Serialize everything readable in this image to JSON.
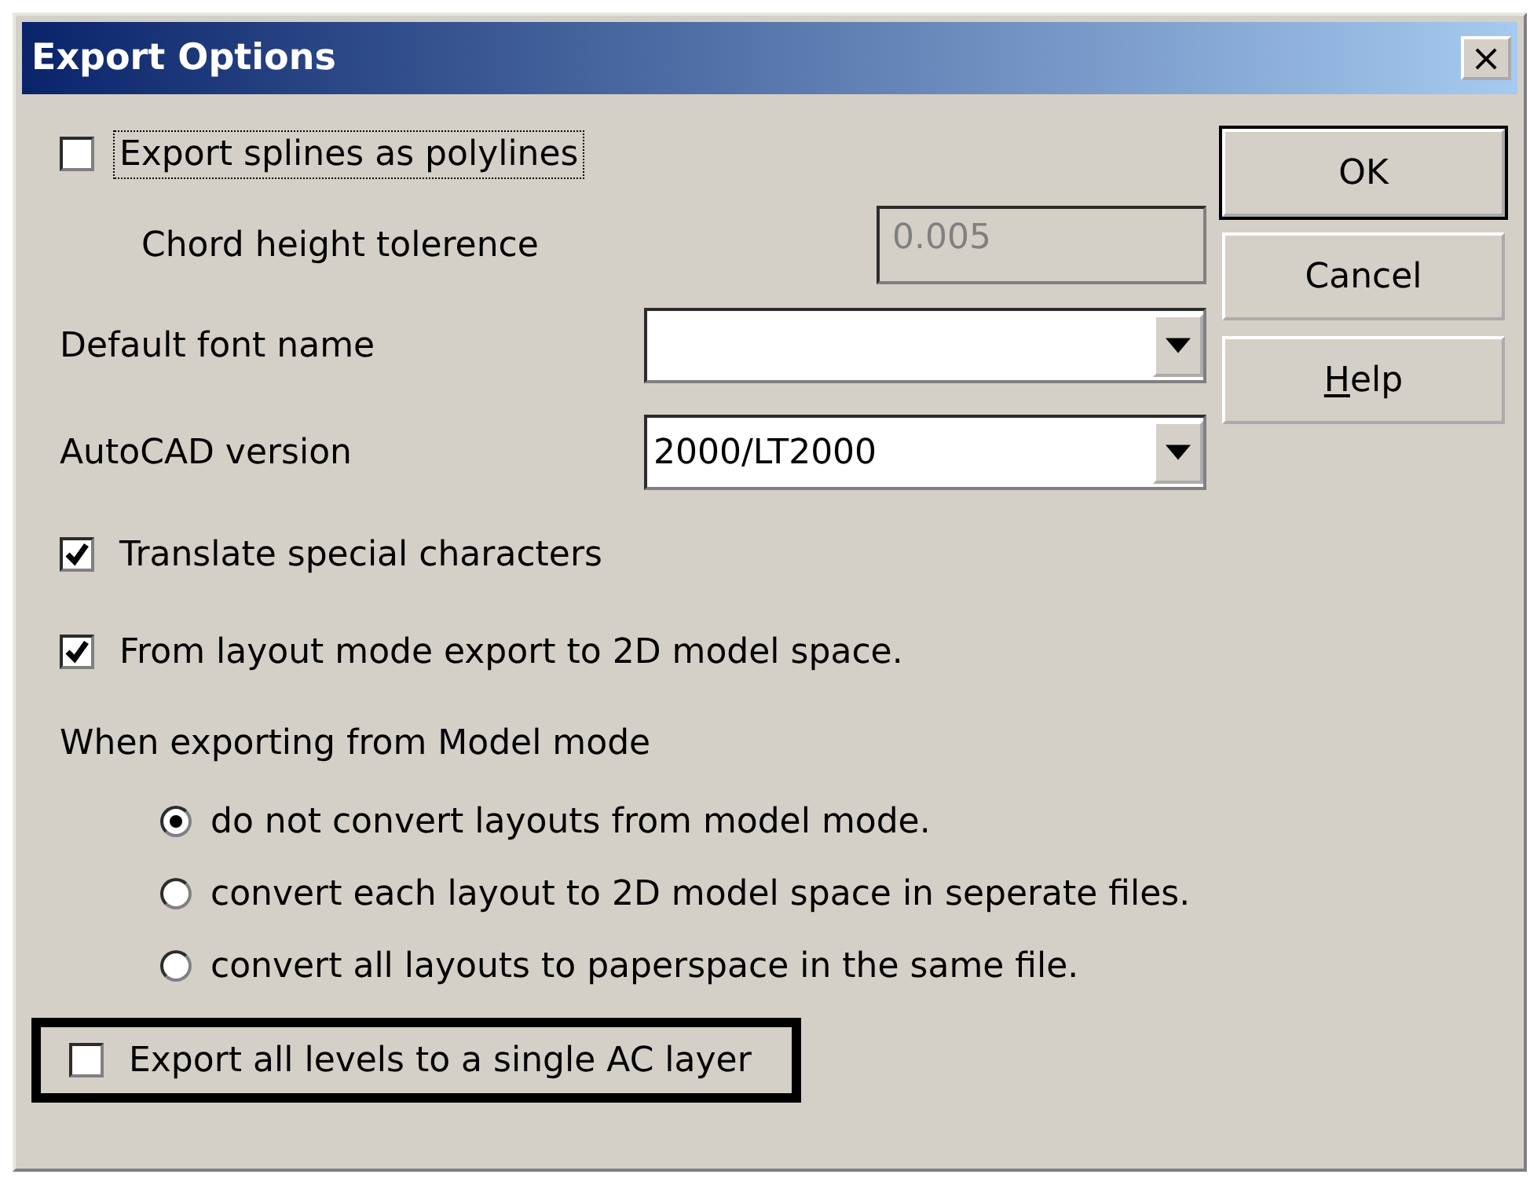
{
  "window": {
    "title": "Export Options",
    "close_label": "×"
  },
  "export_splines": {
    "label": "Export splines as polylines",
    "checked": false,
    "focused": true
  },
  "chord_height": {
    "label": "Chord height tolerence",
    "value": "0.005",
    "disabled": true
  },
  "fields": [
    {
      "label": "Default font name"
    },
    {
      "label": "AutoCAD version",
      "value": "2000/LT2000"
    }
  ],
  "options": [
    {
      "label": "Translate special characters",
      "checked": true
    },
    {
      "label": "From layout mode export to 2D model space.",
      "checked": true
    }
  ],
  "model_mode": {
    "label": "When exporting from Model mode",
    "choices": [
      {
        "label": "do not convert layouts from model mode.",
        "selected": true
      },
      {
        "label": "convert each layout to 2D model space in seperate files.",
        "selected": false
      },
      {
        "label": "convert all layouts to paperspace in the same file.",
        "selected": false
      }
    ]
  },
  "single_layer": {
    "label": "Export all levels to a single AC layer",
    "checked": false,
    "highlighted": true
  },
  "buttons": [
    {
      "label": "OK",
      "default": true,
      "first_letter_underlined": false
    },
    {
      "label": "Cancel",
      "default": false,
      "first_letter_underlined": false
    },
    {
      "label": "Help",
      "default": false,
      "first_letter_underlined": true
    }
  ]
}
